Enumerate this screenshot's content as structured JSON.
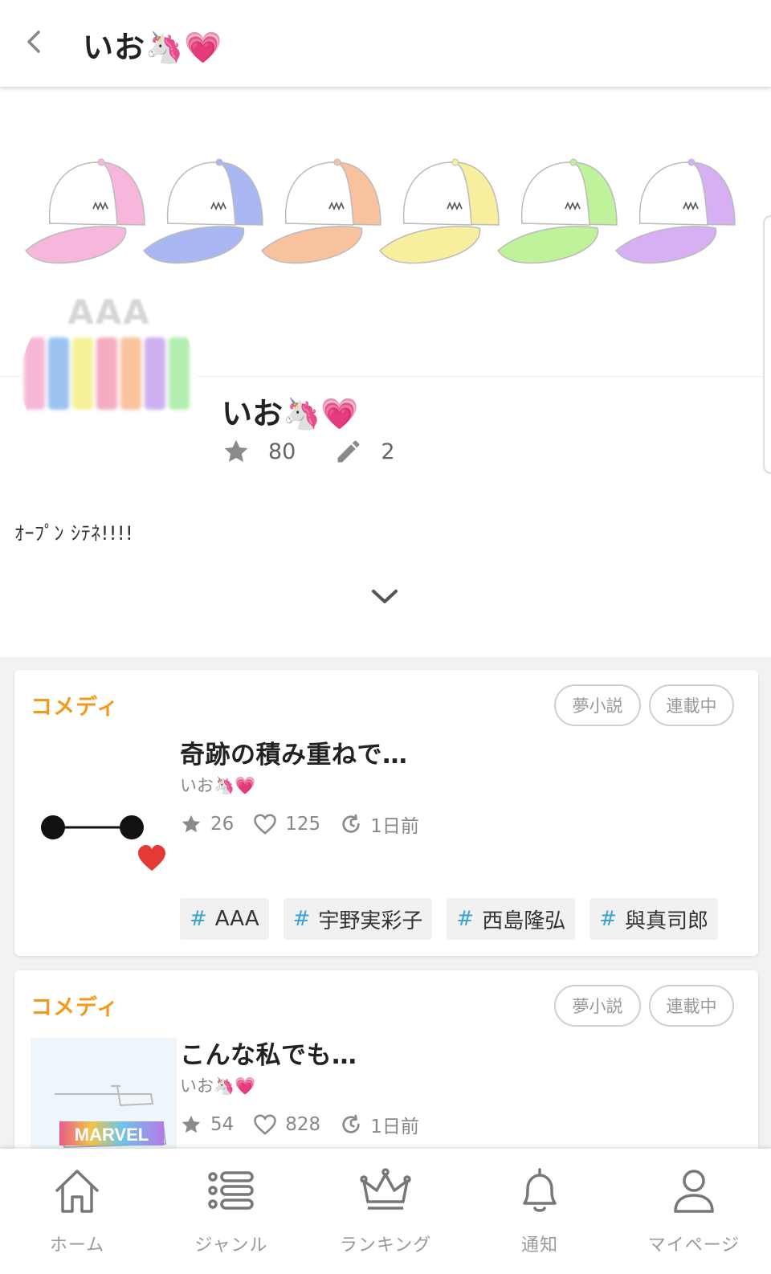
{
  "header": {
    "title": "いお🦄💗",
    "back_icon": "chevron-left-icon"
  },
  "cover": {
    "cap_colors": [
      "#f7b6dc",
      "#a9b8f2",
      "#f8c29e",
      "#f8ef9e",
      "#bff29a",
      "#d7b0f4"
    ],
    "avatar_text": "AAA",
    "avatar_colors": [
      "#f4a9cf",
      "#8ab7ee",
      "#f5ef87",
      "#f29db5",
      "#f8b98d",
      "#c6a2ef",
      "#a7eaa2"
    ]
  },
  "profile": {
    "name": "いお🦄💗",
    "stars": "80",
    "works": "2",
    "bio": "ｵｰﾌﾟﾝ ｼﾃﾈ!!!!"
  },
  "stories": [
    {
      "genre": "コメディ",
      "badges": [
        "夢小説",
        "連載中"
      ],
      "title": "奇跡の積み重ねで…",
      "author": "いお🦄💗",
      "stars": "26",
      "likes": "125",
      "updated": "1日前",
      "tags": [
        "AAA",
        "宇野実彩子",
        "西島隆弘",
        "與真司郎"
      ]
    },
    {
      "genre": "コメディ",
      "badges": [
        "夢小説",
        "連載中"
      ],
      "title": "こんな私でも…",
      "author": "いお🦄💗",
      "stars": "54",
      "likes": "828",
      "updated": "1日前",
      "thumb_text": "MARVEL"
    }
  ],
  "nav": [
    {
      "label": "ホーム",
      "icon": "home-icon"
    },
    {
      "label": "ジャンル",
      "icon": "list-icon"
    },
    {
      "label": "ランキング",
      "icon": "crown-icon"
    },
    {
      "label": "通知",
      "icon": "bell-icon"
    },
    {
      "label": "マイページ",
      "icon": "person-icon"
    }
  ],
  "colors": {
    "genre": "#f39a1e",
    "tag_hash": "#3aa0d8",
    "heart": "#e53935"
  }
}
